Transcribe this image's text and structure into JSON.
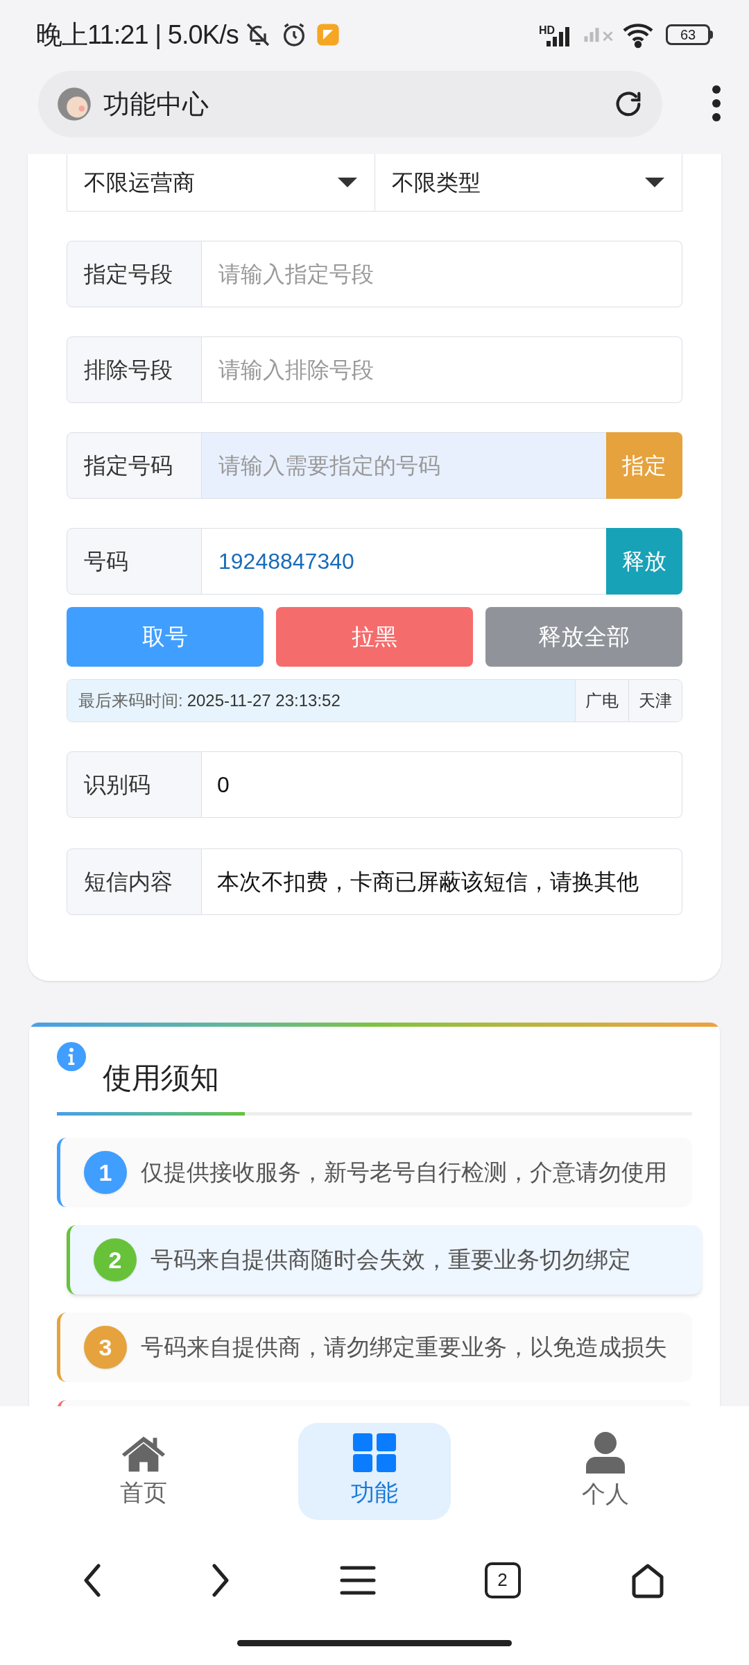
{
  "status_bar": {
    "time": "晚上11:21 | 5.0K/s",
    "network_label": "HD",
    "battery": "63"
  },
  "browser": {
    "title": "功能中心"
  },
  "filters": [
    {
      "label": "不限运营商"
    },
    {
      "label": "不限类型"
    }
  ],
  "fields": [
    {
      "kind": "input",
      "label": "指定号段",
      "placeholder": "请输入指定号段"
    },
    {
      "kind": "input",
      "label": "排除号段",
      "placeholder": "请输入排除号段"
    },
    {
      "kind": "assign",
      "label": "指定号码",
      "placeholder": "请输入需要指定的号码",
      "button": "指定"
    },
    {
      "kind": "release",
      "label": "号码",
      "value": "19248847340",
      "button": "释放"
    }
  ],
  "actions": [
    {
      "label": "取号",
      "kind": "primary"
    },
    {
      "label": "拉黑",
      "kind": "danger"
    },
    {
      "label": "释放全部",
      "kind": "neutral"
    }
  ],
  "info": {
    "label": "最后来码时间:",
    "time": "2025-11-27 23:13:52",
    "tags": [
      "广电",
      "天津"
    ]
  },
  "results": [
    {
      "label": "识别码",
      "value": "0"
    },
    {
      "label": "短信内容",
      "value": "本次不扣费，卡商已屏蔽该短信，请换其他"
    }
  ],
  "notice": {
    "title": "使用须知",
    "items": [
      {
        "number": "1",
        "text": "仅提供接收服务，新号老号自行检测，介意请勿使用",
        "color": "#409eff",
        "highlighted": false
      },
      {
        "number": "2",
        "text": "号码来自提供商随时会失效，重要业务切勿绑定",
        "color": "#67c23a",
        "highlighted": true
      },
      {
        "number": "3",
        "text": "号码来自提供商，请勿绑定重要业务，以免造成损失",
        "color": "#e6a23c",
        "highlighted": false
      },
      {
        "color": "#f56c6c",
        "highlighted": false
      }
    ]
  },
  "nav": [
    {
      "label": "首页",
      "kind": "home",
      "selected": false
    },
    {
      "label": "功能",
      "kind": "grid",
      "selected": true
    },
    {
      "label": "个人",
      "kind": "person",
      "selected": false
    }
  ],
  "browser_bar": {
    "tab_count": "2"
  }
}
